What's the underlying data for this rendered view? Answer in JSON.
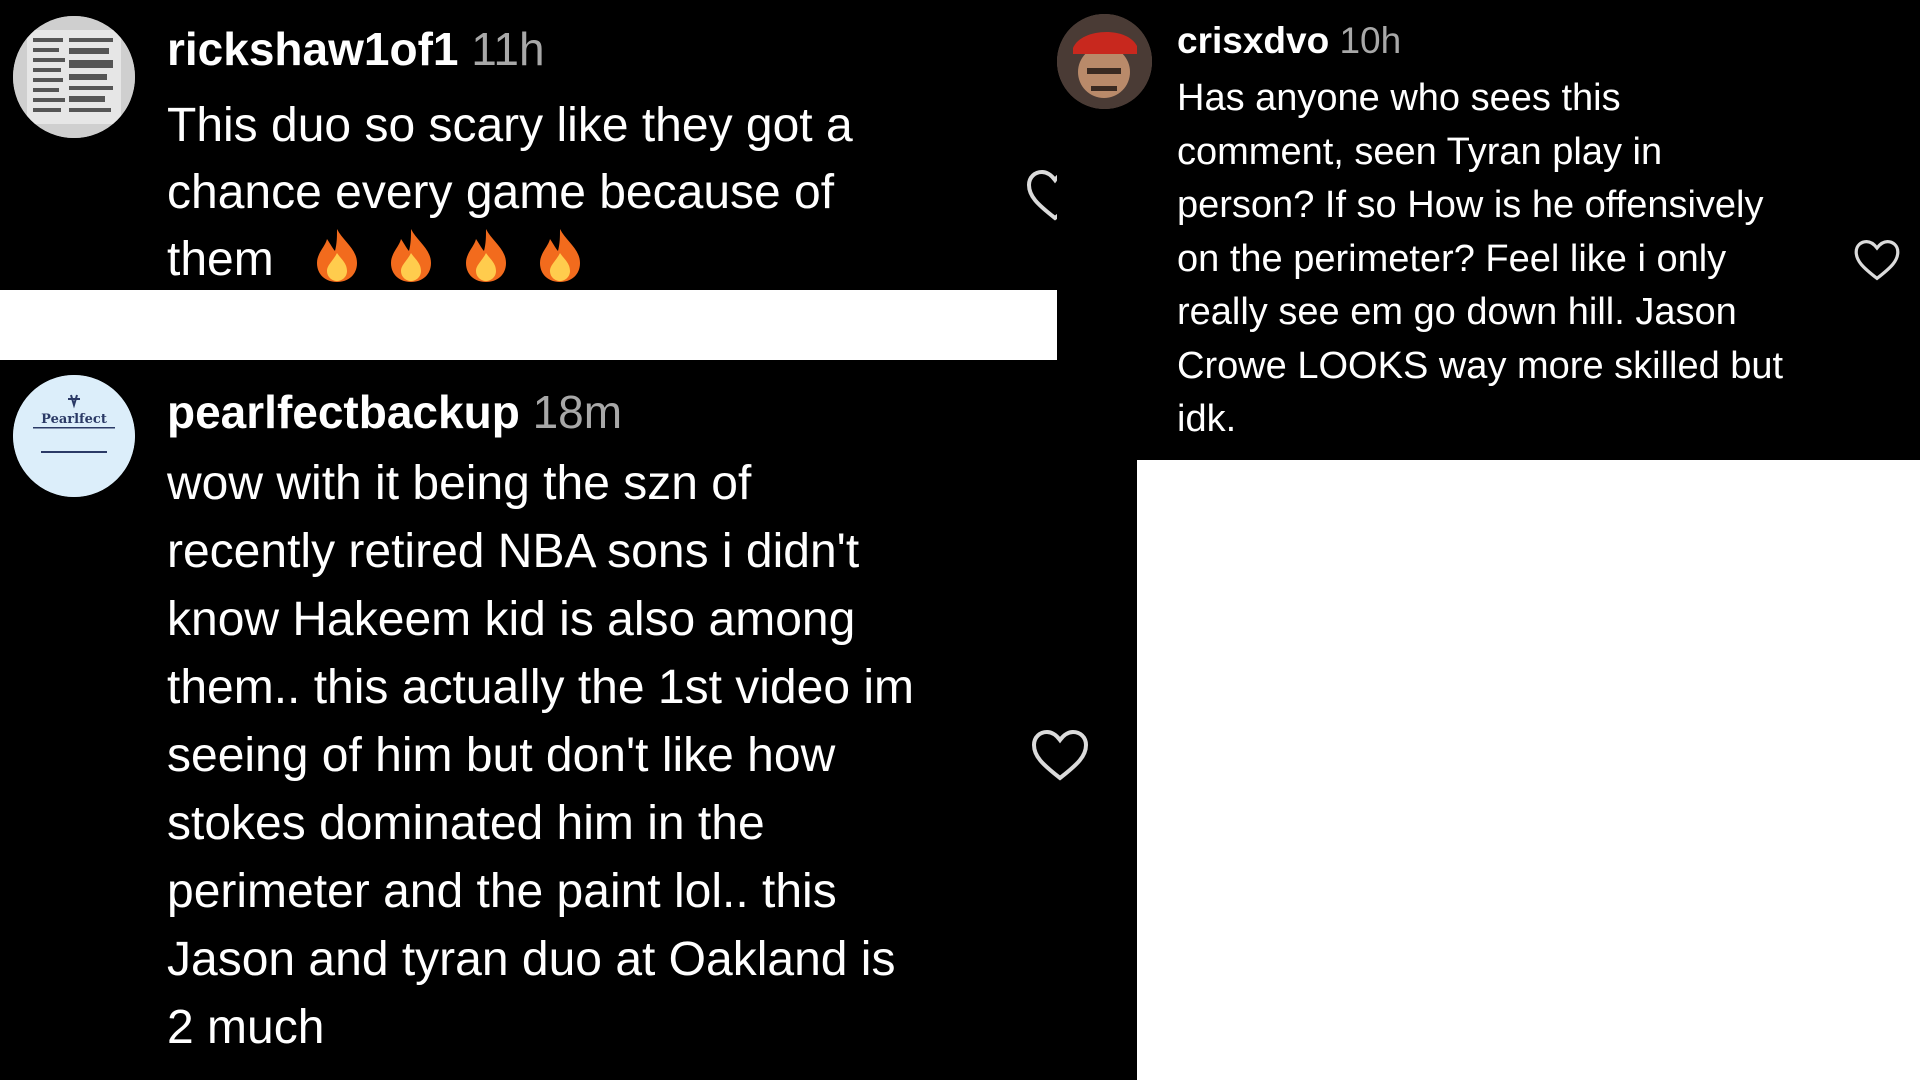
{
  "comments": [
    {
      "username": "rickshaw1of1",
      "time": "11h",
      "text": "This duo so scary like they got a\nchance every game because of\nthem",
      "emojis": [
        "fire-emoji",
        "fire-emoji",
        "fire-emoji",
        "fire-emoji"
      ],
      "avatar_icon": "avatar-rickshaw1of1"
    },
    {
      "username": "pearlfectbackup",
      "time": "18m",
      "text": "wow with it being the szn of\nrecently retired NBA sons i didn't\nknow Hakeem kid is also among\nthem.. this actually the 1st video im\nseeing of him but don't like how\nstokes dominated him in the\nperimeter and the paint lol.. this\nJason and tyran duo at Oakland is\n2 much",
      "avatar_text": "Pearlfect",
      "avatar_icon": "avatar-pearlfectbackup"
    },
    {
      "username": "crisxdvo",
      "time": "10h",
      "text": "Has anyone who sees this\ncomment, seen Tyran play in\nperson? If so How is he offensively\non the perimeter? Feel like i only\nreally see em go down hill. Jason\nCrowe LOOKS way more skilled but\nidk.",
      "avatar_icon": "avatar-crisxdvo"
    }
  ],
  "icons": {
    "like": "heart-outline-icon",
    "fire": "fire-emoji"
  },
  "colors": {
    "panel_bg": "#000000",
    "page_bg": "#ffffff",
    "text": "#ffffff",
    "timestamp": "#a8a8a8",
    "fire_outer": "#f26b1d",
    "fire_inner": "#ffcc4d"
  }
}
